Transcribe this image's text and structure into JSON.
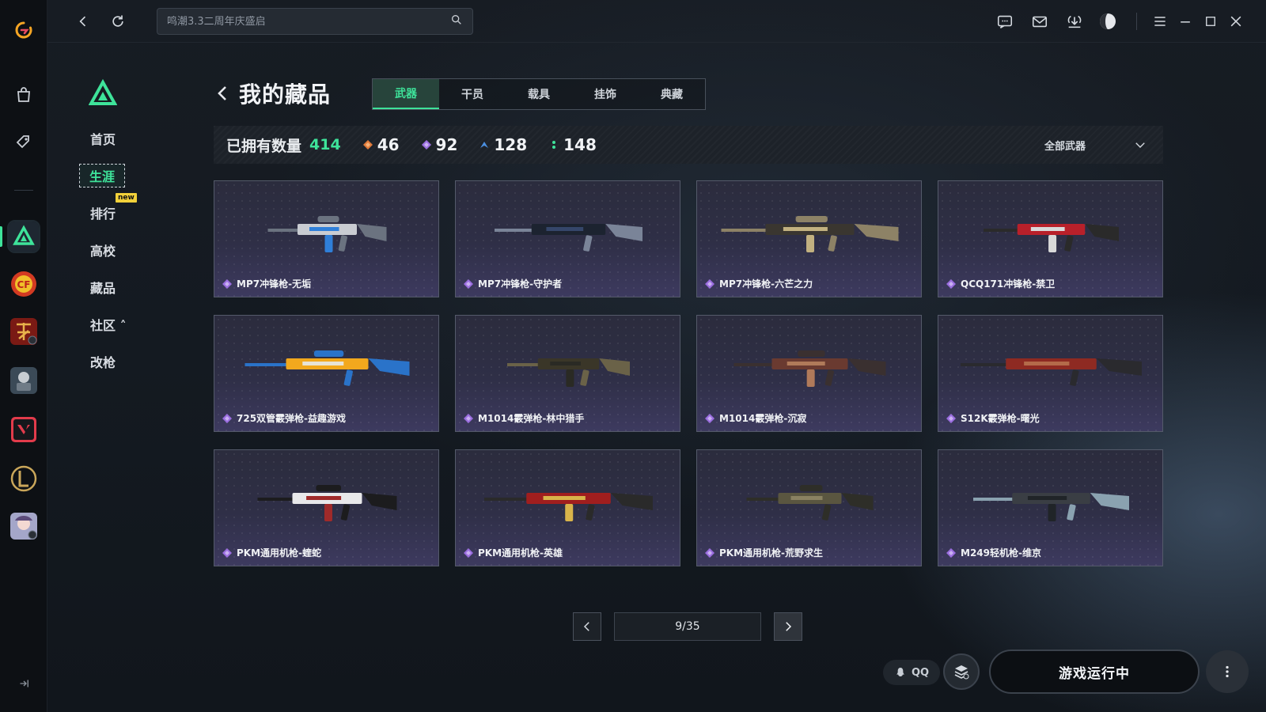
{
  "search": {
    "placeholder": "鸣潮3.3二周年庆盛启"
  },
  "sidebar": {
    "items": [
      {
        "label": "首页"
      },
      {
        "label": "生涯"
      },
      {
        "label": "排行"
      },
      {
        "label": "高校"
      },
      {
        "label": "藏品"
      },
      {
        "label": "社区 ˄"
      },
      {
        "label": "改枪"
      }
    ],
    "new_badge": "new",
    "active_index": 1
  },
  "page": {
    "title": "我的藏品",
    "tabs": [
      "武器",
      "干员",
      "载具",
      "挂饰",
      "典藏"
    ],
    "active_tab": 0
  },
  "stats": {
    "owned_label": "已拥有数量",
    "owned_total": "414",
    "tiers": [
      {
        "value": "46",
        "color": "#e07a3a"
      },
      {
        "value": "92",
        "color": "#9b6ee0"
      },
      {
        "value": "128",
        "color": "#4b8fe0"
      },
      {
        "value": "148",
        "color": "#3ee39a"
      }
    ],
    "filter_label": "全部武器"
  },
  "items": [
    {
      "name": "MP7冲锋枪-无垢",
      "palette": [
        "#c9ccd2",
        "#6b7380",
        "#2f7fd9"
      ]
    },
    {
      "name": "MP7冲锋枪-守护者",
      "palette": [
        "#1c2330",
        "#7a8498",
        "#35466a"
      ]
    },
    {
      "name": "MP7冲锋枪-六芒之力",
      "palette": [
        "#3a3630",
        "#8d8266",
        "#c2b180"
      ]
    },
    {
      "name": "QCQ171冲锋枪-禁卫",
      "palette": [
        "#b8202a",
        "#2a2a2a",
        "#d9d9d9"
      ]
    },
    {
      "name": "725双管霰弹枪-益趣游戏",
      "palette": [
        "#f2a81d",
        "#2a73c9",
        "#e8e4d6"
      ]
    },
    {
      "name": "M1014霰弹枪-林中猎手",
      "palette": [
        "#3a3628",
        "#6a6248",
        "#2a2a24"
      ]
    },
    {
      "name": "M1014霰弹枪-沉寂",
      "palette": [
        "#6a3a30",
        "#3a3030",
        "#b07a5a"
      ]
    },
    {
      "name": "S12K霰弹枪-曙光",
      "palette": [
        "#8e2a22",
        "#2a2a2e",
        "#b46a4a"
      ]
    },
    {
      "name": "PKM通用机枪-蝰蛇",
      "palette": [
        "#e8e8ea",
        "#1c1c1e",
        "#a02a2a"
      ]
    },
    {
      "name": "PKM通用机枪-英雄",
      "palette": [
        "#a01e1e",
        "#2a2a2a",
        "#d9b44a"
      ]
    },
    {
      "name": "PKM通用机枪-荒野求生",
      "palette": [
        "#5a5640",
        "#2e2e28",
        "#8a8262"
      ]
    },
    {
      "name": "M249轻机枪-维京",
      "palette": [
        "#3a3e44",
        "#8aa2b0",
        "#202428"
      ]
    }
  ],
  "pagination": {
    "text": "9/35"
  },
  "bottom": {
    "qq_label": "QQ",
    "run_label": "游戏运行中"
  },
  "colors": {
    "accent": "#3ee39a",
    "rarity_purple": "#9b6ee0"
  }
}
